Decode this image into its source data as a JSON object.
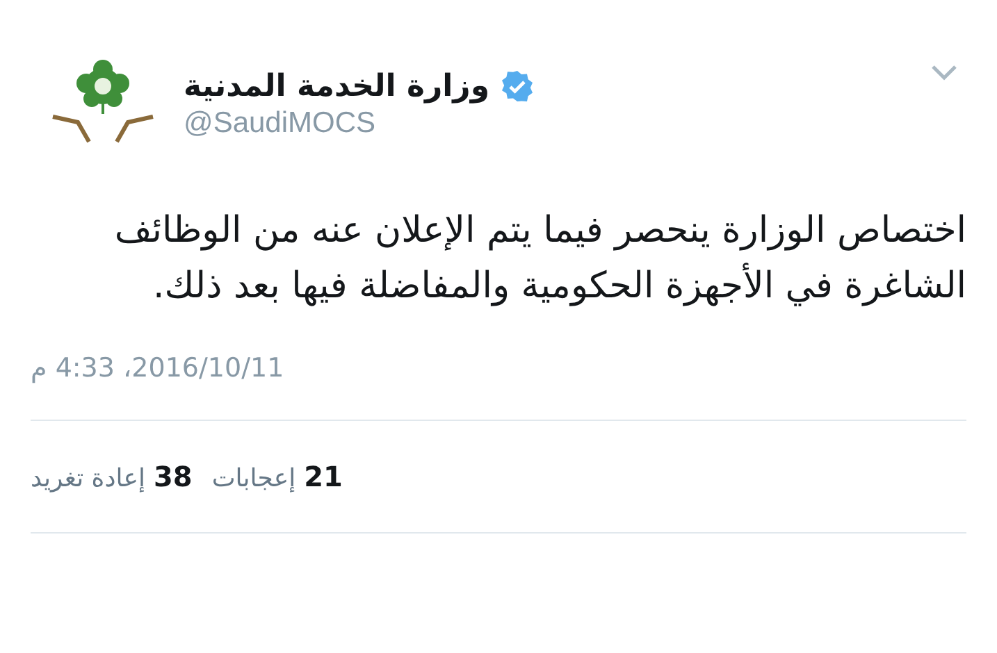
{
  "tweet": {
    "author": {
      "name": "وزارة الخدمة المدنية",
      "handle": "@SaudiMOCS",
      "verified": true
    },
    "text": "اختصاص الوزارة ينحصر فيما يتم الإعلان عنه من الوظائف الشاغرة في الأجهزة الحكومية والمفاضلة فيها بعد ذلك.",
    "timestamp": "2016/10/11، 4:33 م",
    "stats": [
      {
        "count": "21",
        "label": "إعجابات"
      },
      {
        "count": "38",
        "label": "إعادة تغريد"
      }
    ]
  }
}
